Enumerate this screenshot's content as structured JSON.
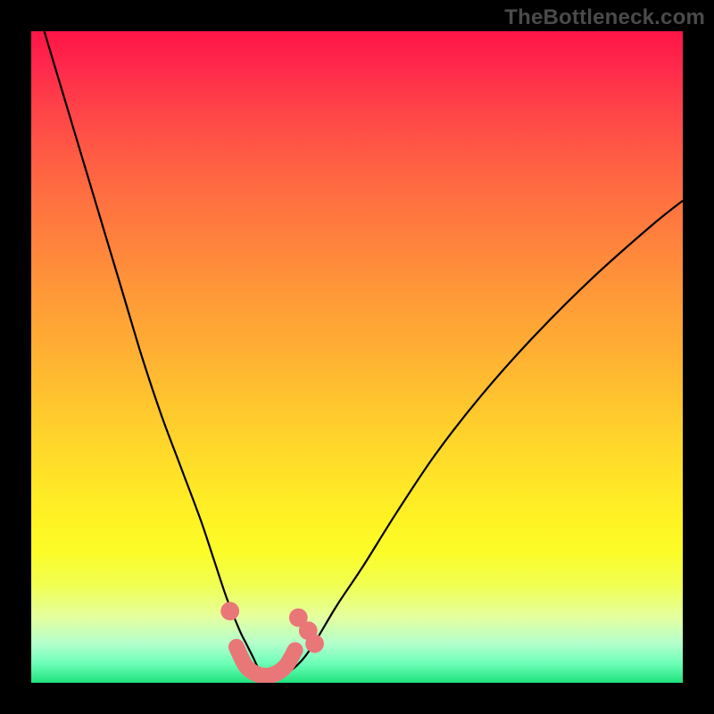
{
  "watermark": "TheBottleneck.com",
  "colors": {
    "curve": "#000000",
    "markers": "#e97777",
    "gradient_top": "#ff1548",
    "gradient_bottom": "#20e37e",
    "frame": "#000000"
  },
  "chart_data": {
    "type": "line",
    "title": "",
    "xlabel": "",
    "ylabel": "",
    "xlim": [
      0,
      100
    ],
    "ylim": [
      0,
      100
    ],
    "grid": false,
    "legend": false,
    "series": [
      {
        "name": "bottleneck-curve",
        "x": [
          2,
          5,
          8,
          11,
          14,
          17,
          20,
          23,
          26,
          28,
          30,
          32,
          33,
          34,
          35,
          36,
          37,
          38,
          40,
          42,
          44,
          47,
          51,
          56,
          62,
          69,
          77,
          86,
          95,
          100
        ],
        "y": [
          100,
          90,
          80,
          70,
          60,
          50,
          41,
          33,
          25,
          19,
          13,
          8,
          6,
          4,
          2,
          1,
          1,
          1,
          2,
          4,
          7,
          12,
          18,
          26,
          35,
          44,
          53,
          62,
          70,
          74
        ]
      }
    ],
    "markers": [
      {
        "x": 30.5,
        "y": 11,
        "r": 1.2
      },
      {
        "x": 41.0,
        "y": 10,
        "r": 1.2
      },
      {
        "x": 42.5,
        "y": 8,
        "r": 1.2
      },
      {
        "x": 43.5,
        "y": 6,
        "r": 1.2
      }
    ],
    "highlight_segment": {
      "x": [
        31.5,
        33,
        35,
        37,
        39,
        40.5
      ],
      "y": [
        5.5,
        2.5,
        1.2,
        1.2,
        2.5,
        5.0
      ]
    }
  }
}
